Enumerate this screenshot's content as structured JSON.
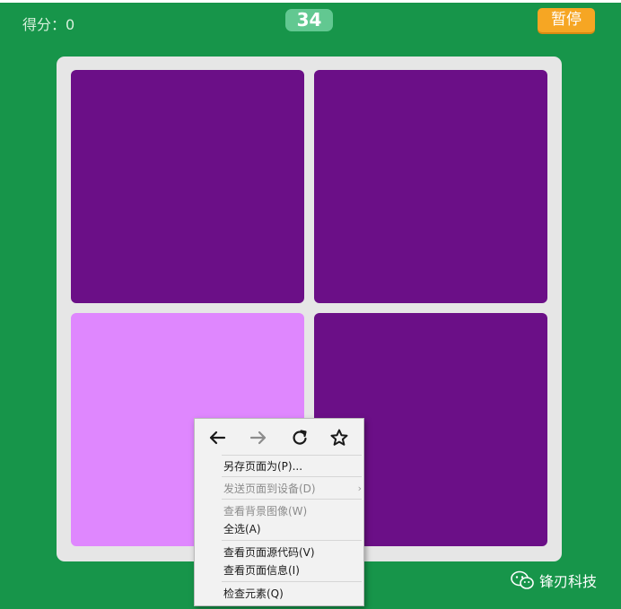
{
  "header": {
    "score_text": "得分：0",
    "timer": "34",
    "pause_label": "暂停"
  },
  "board": {
    "tiles": [
      {
        "color": "#6b0f87"
      },
      {
        "color": "#6b0f87"
      },
      {
        "color": "#df87fe"
      },
      {
        "color": "#6b0f87"
      }
    ]
  },
  "context_menu": {
    "nav_icons": [
      "back-arrow-icon",
      "forward-arrow-icon",
      "reload-icon",
      "bookmark-star-icon"
    ],
    "items": {
      "save_page": "另存页面为(P)...",
      "send_page": "发送页面到设备(D)",
      "view_bg_image": "查看背景图像(W)",
      "select_all": "全选(A)",
      "view_source": "查看页面源代码(V)",
      "view_info": "查看页面信息(I)",
      "inspect": "检查元素(Q)"
    }
  },
  "watermark": {
    "icon": "wechat-icon",
    "text": "锋刃科技"
  },
  "colors": {
    "background": "#17954a",
    "timer_bg": "#62c891",
    "pause_bg": "#f6a623",
    "board_bg": "#e6e6e6",
    "tile_normal": "#6b0f87",
    "tile_odd": "#df87fe"
  }
}
